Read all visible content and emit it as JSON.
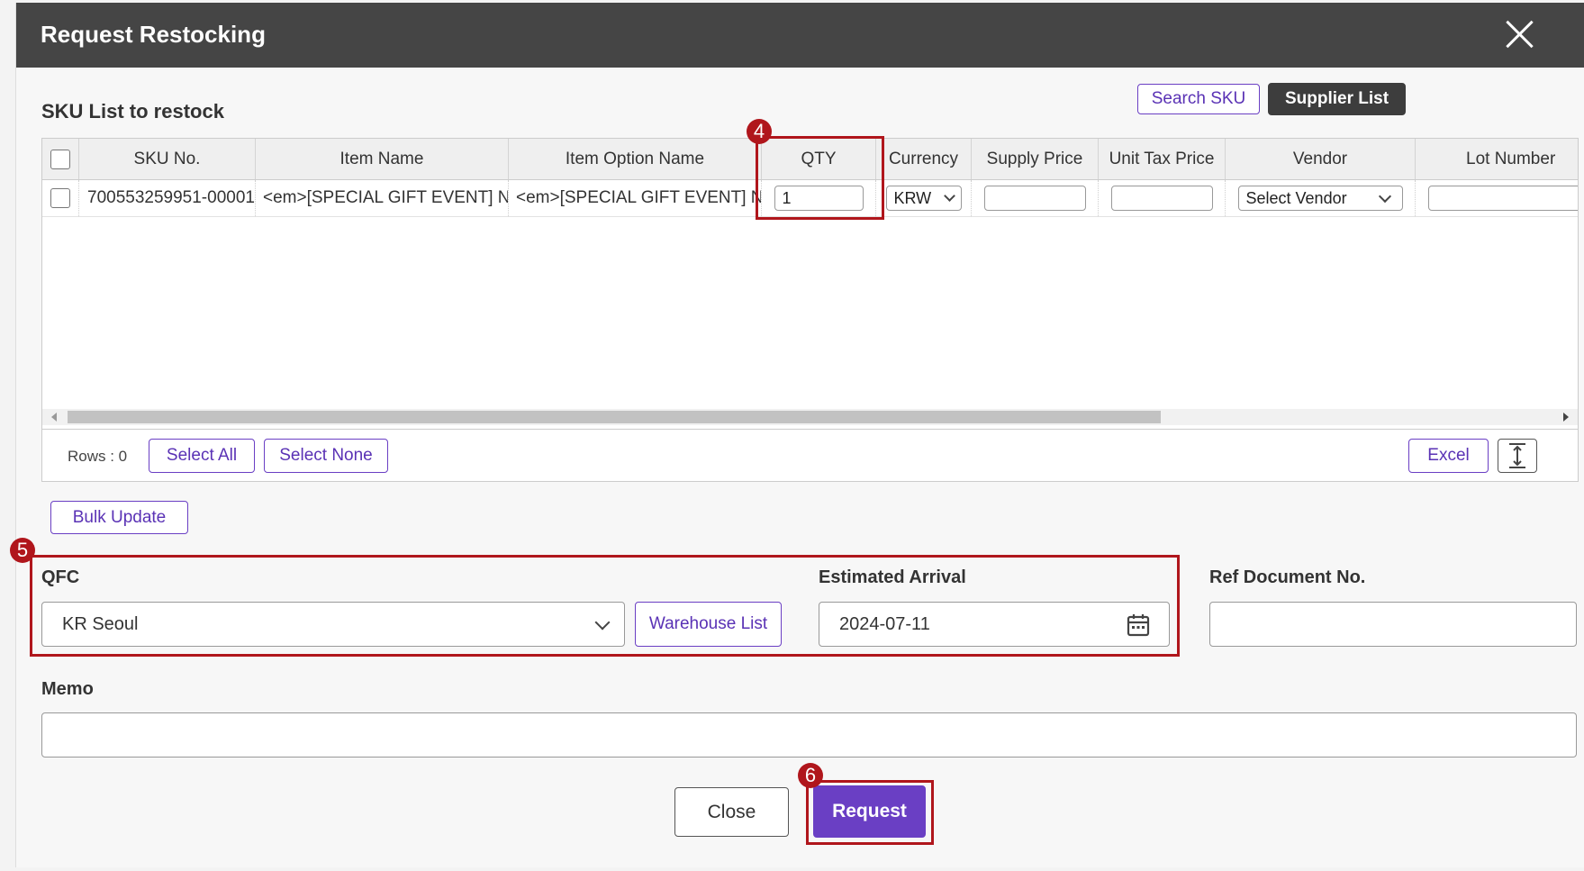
{
  "dialog": {
    "title": "Request Restocking"
  },
  "sku_list": {
    "title": "SKU List to restock",
    "search_sku_label": "Search SKU",
    "supplier_list_label": "Supplier List",
    "columns": [
      "SKU No.",
      "Item Name",
      "Item Option Name",
      "QTY",
      "Currency",
      "Supply Price",
      "Unit Tax Price",
      "Vendor",
      "Lot Number"
    ],
    "rows": [
      {
        "sku_no": "700553259951-00001",
        "item_name": "<em>[SPECIAL GIFT EVENT] N...",
        "item_option_name": "<em>[SPECIAL GIFT EVENT] N...",
        "qty": "1",
        "currency": "KRW",
        "supply_price": "",
        "unit_tax_price": "",
        "vendor": "Select Vendor",
        "lot_number": ""
      }
    ],
    "rows_count": "Rows : 0",
    "select_all_label": "Select All",
    "select_none_label": "Select None",
    "excel_label": "Excel"
  },
  "bulk_update_label": "Bulk Update",
  "form": {
    "qfc_label": "QFC",
    "qfc_value": "KR Seoul",
    "warehouse_list_label": "Warehouse List",
    "estimated_arrival_label": "Estimated Arrival",
    "estimated_arrival_value": "2024-07-11",
    "ref_document_label": "Ref Document No.",
    "ref_document_value": "",
    "memo_label": "Memo",
    "memo_value": ""
  },
  "actions": {
    "close_label": "Close",
    "request_label": "Request"
  },
  "annotations": {
    "qty_marker": "4",
    "location_marker": "5",
    "request_marker": "6"
  },
  "colors": {
    "header_bg": "#454545",
    "accent": "#6a3fc4",
    "annotation": "#b0161c"
  }
}
